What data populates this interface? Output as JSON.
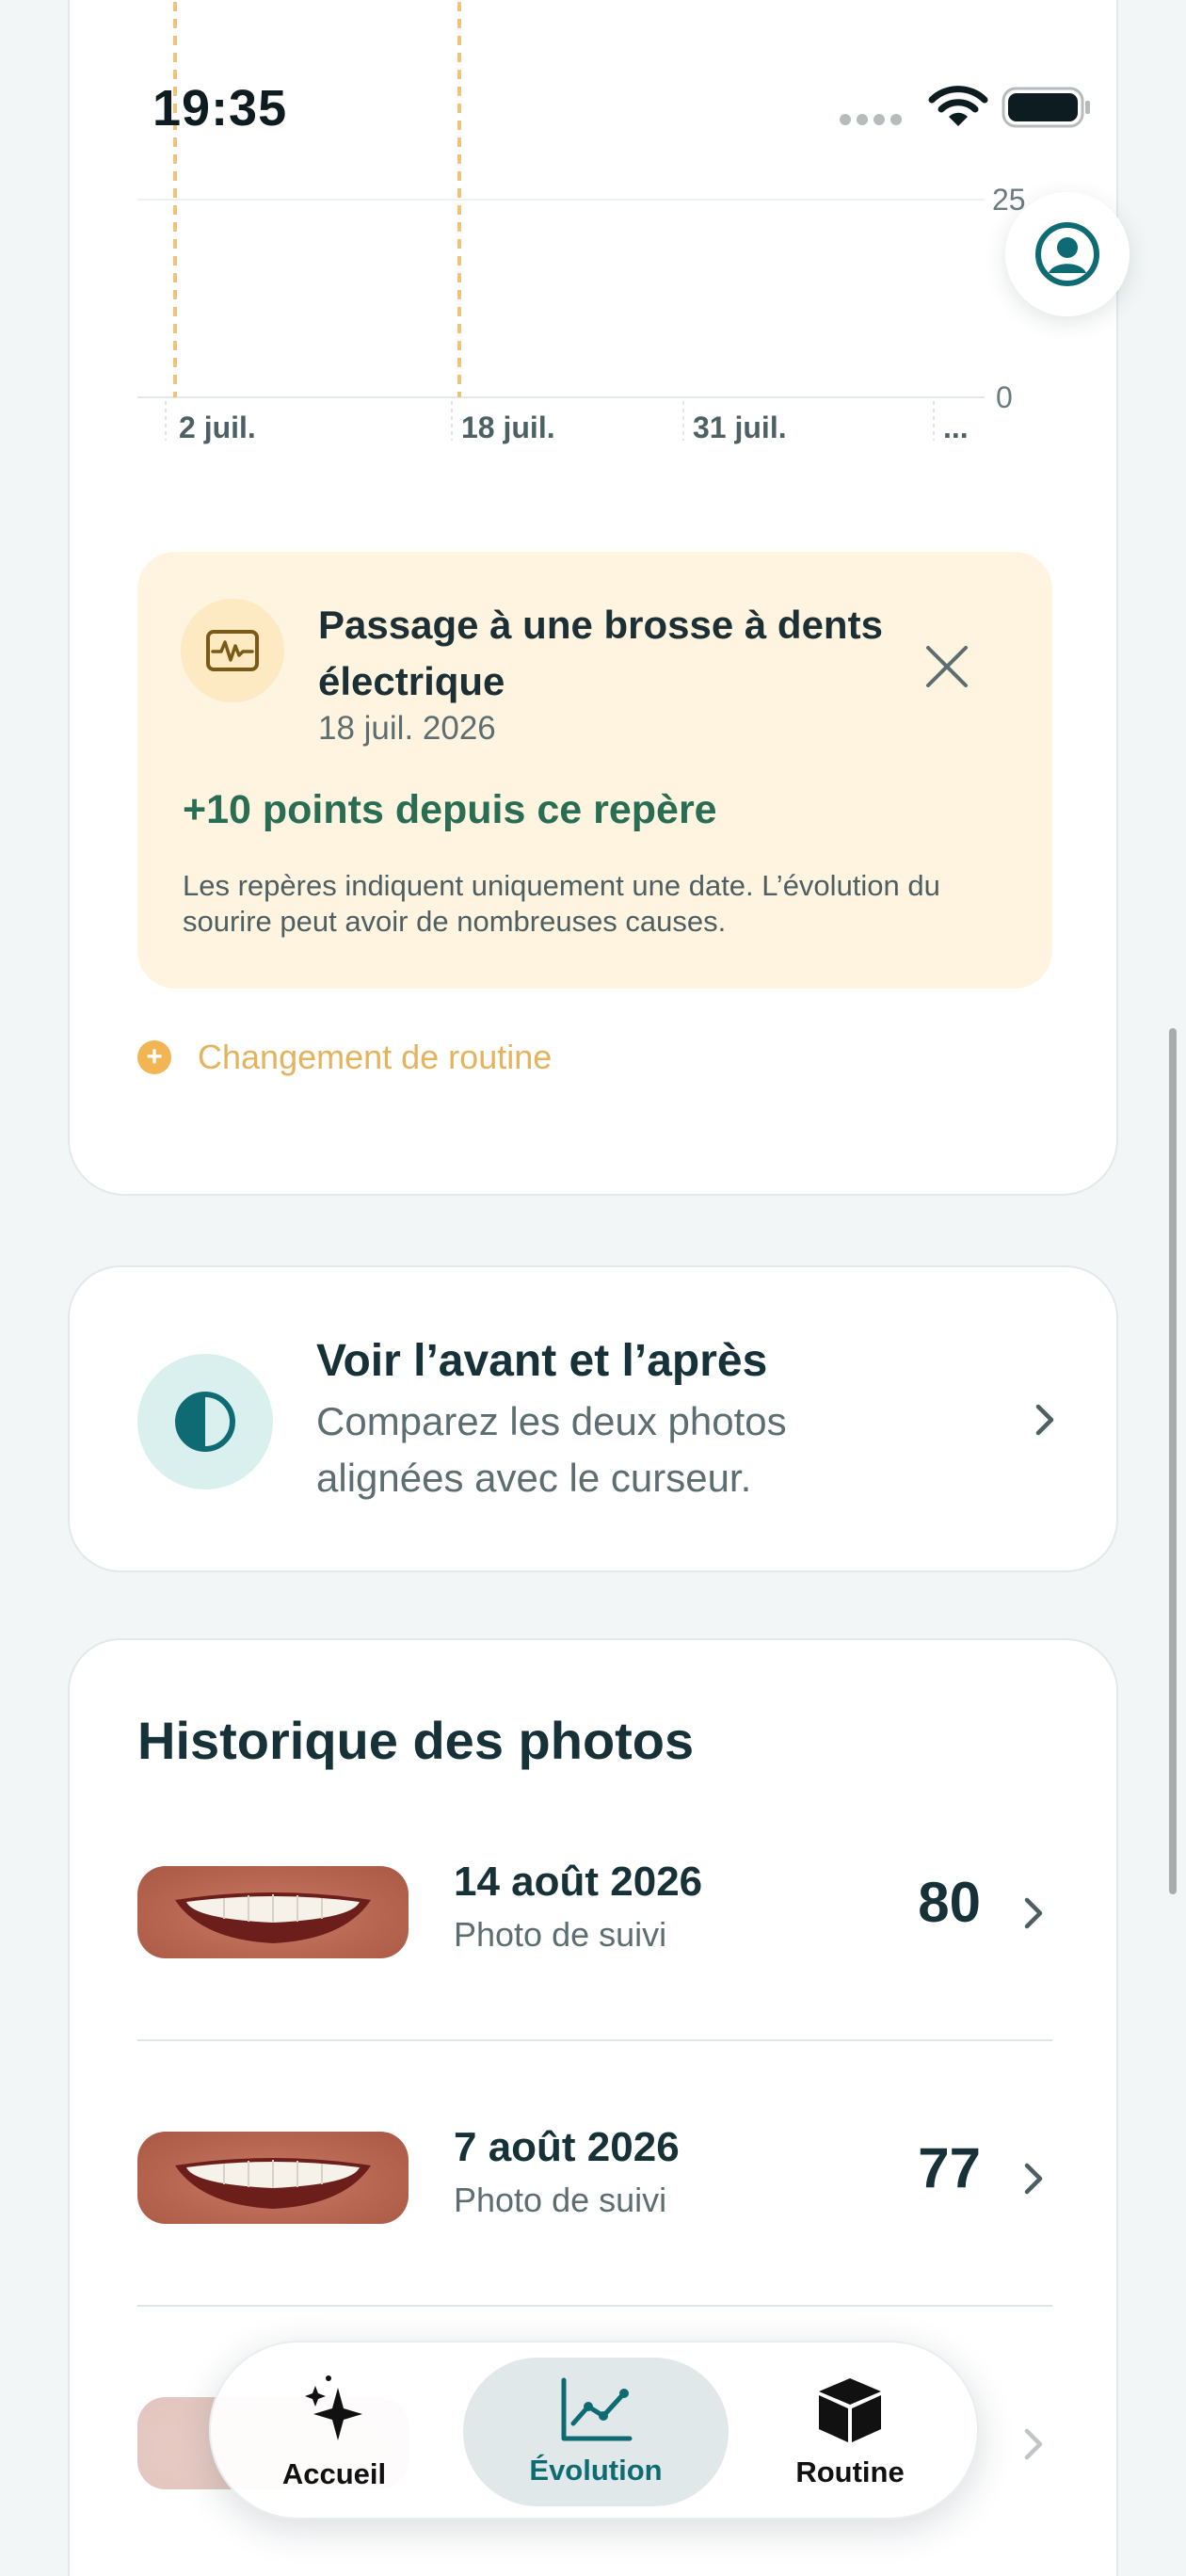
{
  "status_bar": {
    "time": "19:35"
  },
  "chart_data": {
    "type": "line",
    "x_ticks": [
      "2 juil.",
      "18 juil.",
      "31 juil.",
      "..."
    ],
    "y_ticks": [
      "25",
      "0"
    ],
    "milestones": [
      "2 juil.",
      "18 juil."
    ],
    "grid": true
  },
  "milestone_card": {
    "icon": "activity-pulse-icon",
    "title": "Passage à une brosse à dents électrique",
    "date": "18 juil. 2026",
    "points": "+10 points depuis ce repère",
    "note": "Les repères indiquent uniquement une date. L’évolution du sourire peut avoir de nombreuses causes."
  },
  "routine_change": {
    "label": "Changement de routine"
  },
  "compare_card": {
    "icon": "contrast-icon",
    "title": "Voir l’avant et l’après",
    "subtitle": "Comparez les deux photos alignées avec le curseur."
  },
  "history": {
    "title": "Historique des photos",
    "items": [
      {
        "date": "14 août 2026",
        "subtitle": "Photo de suivi",
        "score": "80"
      },
      {
        "date": "7 août 2026",
        "subtitle": "Photo de suivi",
        "score": "77"
      },
      {
        "date": "",
        "subtitle": "",
        "score": ""
      }
    ]
  },
  "tabbar": {
    "tabs": [
      {
        "label": "Accueil",
        "icon": "sparkles-icon",
        "active": false
      },
      {
        "label": "Évolution",
        "icon": "chart-line-icon",
        "active": true
      },
      {
        "label": "Routine",
        "icon": "box-icon",
        "active": false
      }
    ]
  },
  "colors": {
    "accent": "#0f6b73",
    "milestone_bg": "#fff4e0",
    "milestone_line": "#f1c27a",
    "positive": "#2a6d55"
  }
}
